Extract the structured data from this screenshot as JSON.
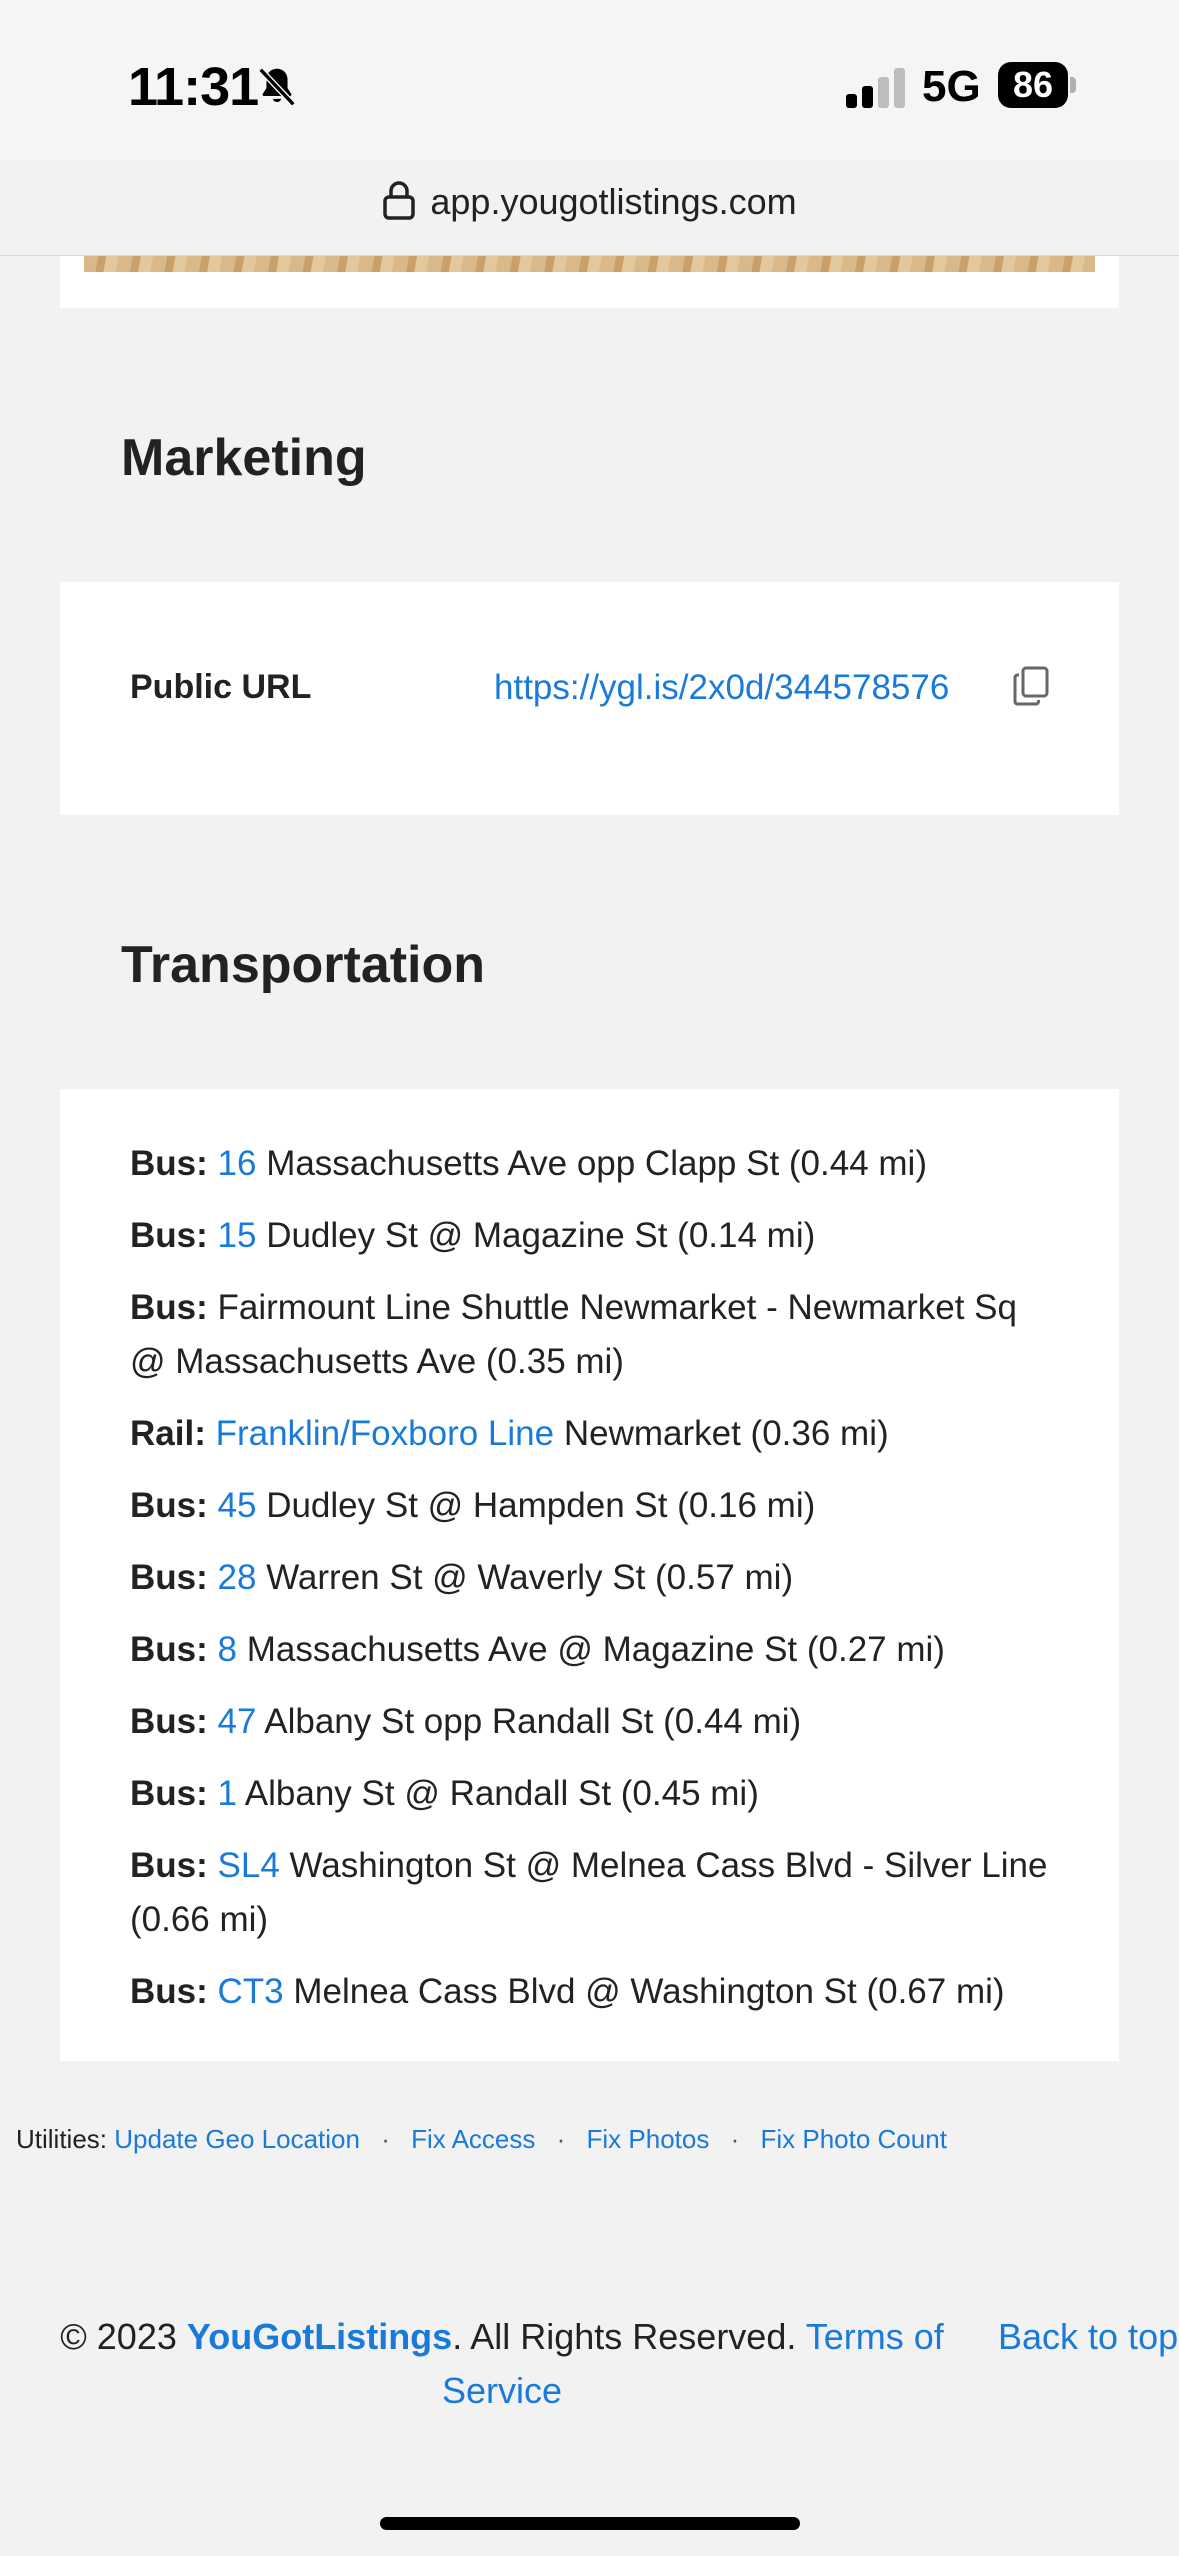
{
  "status_bar": {
    "time": "11:31",
    "network": "5G",
    "battery": "86",
    "icons": [
      "bell-slash-icon",
      "signal-icon",
      "battery-icon"
    ]
  },
  "browser": {
    "url": "app.yougotlistings.com",
    "lock_icon": "lock-icon"
  },
  "marketing": {
    "title": "Marketing",
    "public_url_label": "Public URL",
    "public_url": "https://ygl.is/2x0d/344578576",
    "copy_icon": "copy-icon"
  },
  "transportation": {
    "title": "Transportation",
    "items": [
      {
        "type": "Bus:",
        "route": "16",
        "desc": "Massachusetts Ave opp Clapp St (0.44 mi)"
      },
      {
        "type": "Bus:",
        "route": "15",
        "desc": "Dudley St @ Magazine St (0.14 mi)"
      },
      {
        "type": "Bus:",
        "route": "",
        "desc": "Fairmount Line Shuttle Newmarket - Newmarket Sq @ Massachusetts Ave (0.35 mi)"
      },
      {
        "type": "Rail:",
        "route": "Franklin/Foxboro Line",
        "desc": "Newmarket (0.36 mi)"
      },
      {
        "type": "Bus:",
        "route": "45",
        "desc": "Dudley St @ Hampden St (0.16 mi)"
      },
      {
        "type": "Bus:",
        "route": "28",
        "desc": "Warren St @ Waverly St (0.57 mi)"
      },
      {
        "type": "Bus:",
        "route": "8",
        "desc": "Massachusetts Ave @ Magazine St (0.27 mi)"
      },
      {
        "type": "Bus:",
        "route": "47",
        "desc": "Albany St opp Randall St (0.44 mi)"
      },
      {
        "type": "Bus:",
        "route": "1",
        "desc": "Albany St @ Randall St (0.45 mi)"
      },
      {
        "type": "Bus:",
        "route": "SL4",
        "desc": "Washington St @ Melnea Cass Blvd - Silver Line (0.66 mi)"
      },
      {
        "type": "Bus:",
        "route": "CT3",
        "desc": "Melnea Cass Blvd @ Washington St (0.67 mi)"
      }
    ]
  },
  "utilities": {
    "label": "Utilities:",
    "links": [
      "Update Geo Location",
      "Fix Access",
      "Fix Photos",
      "Fix Photo Count"
    ],
    "separator": "·"
  },
  "footer": {
    "copyright_prefix": "© 2023",
    "brand": "YouGotListings",
    "rights": ". All Rights Reserved.",
    "terms": "Terms of Service",
    "back_to_top": "Back to top"
  },
  "colors": {
    "link": "#1a7ad9",
    "background": "#f2f2f2",
    "card": "#ffffff",
    "text": "#222222"
  }
}
